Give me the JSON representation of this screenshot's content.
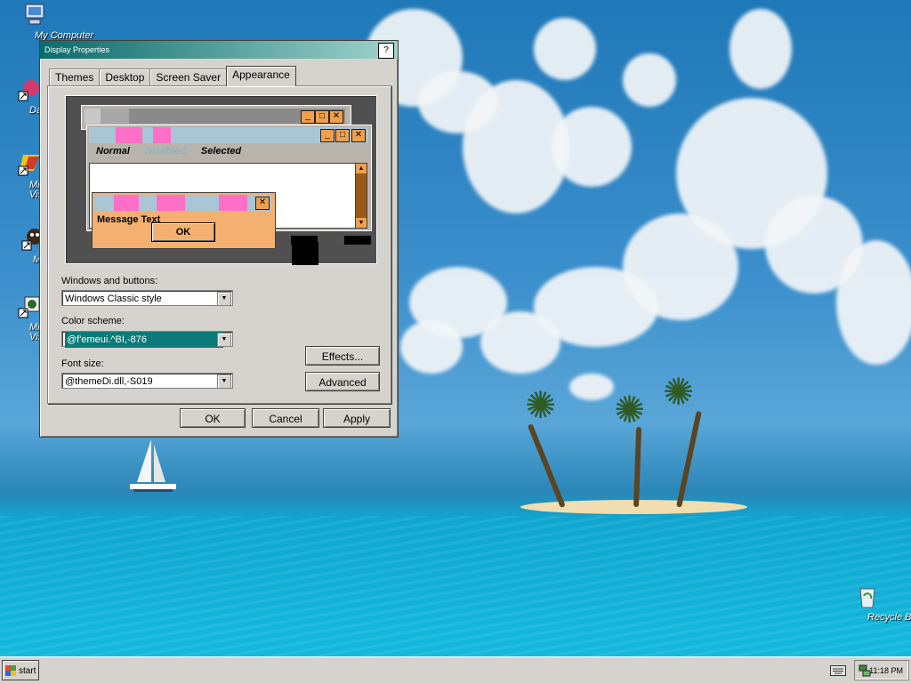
{
  "desktop": {
    "icons": [
      {
        "label": "My Computer",
        "glyph": "computer-icon"
      },
      {
        "label": "DataWa",
        "glyph": "datawa-icon"
      },
      {
        "label": "Micro",
        "label2": "Visual C",
        "glyph": "visual-c-icon"
      },
      {
        "label": "Myp",
        "glyph": "myp-icon"
      },
      {
        "label": "Micro",
        "label2": "Visual J",
        "glyph": "visual-j-icon"
      },
      {
        "label": "Recycle Bin",
        "glyph": "recycle-bin-icon"
      }
    ]
  },
  "dialog": {
    "title": "Display Properties",
    "help": "?",
    "tabs": [
      "Themes",
      "Desktop",
      "Screen Saver",
      "Appearance"
    ],
    "active_tab": "Appearance",
    "preview": {
      "menu_normal": "Normal",
      "menu_disabled": "Disabled",
      "menu_selected": "Selected",
      "message_text": "Message Text",
      "ok_label": "OK",
      "min": "_",
      "max": "□",
      "close": "✕"
    },
    "windows_buttons_label": "Windows and buttons:",
    "windows_buttons_value": "Windows Classic style",
    "color_scheme_label": "Color scheme:",
    "color_scheme_value": "@f'emeui.^BI,-876",
    "font_size_label": "Font size:",
    "font_size_value": "@themeDi.dll,-S019",
    "effects_label": "Effects...",
    "advanced_label": "Advanced",
    "ok_label": "OK",
    "cancel_label": "Cancel",
    "apply_label": "Apply"
  },
  "taskbar": {
    "start_label": "start",
    "clock": "11:18 PM"
  },
  "colors": {
    "title_gradient_start": "#0b6b6b",
    "title_gradient_end": "#a0d3cc",
    "scheme_highlight": "#0b7a78",
    "preview_pink": "#ff6fc7",
    "preview_orange": "#f4b070"
  }
}
